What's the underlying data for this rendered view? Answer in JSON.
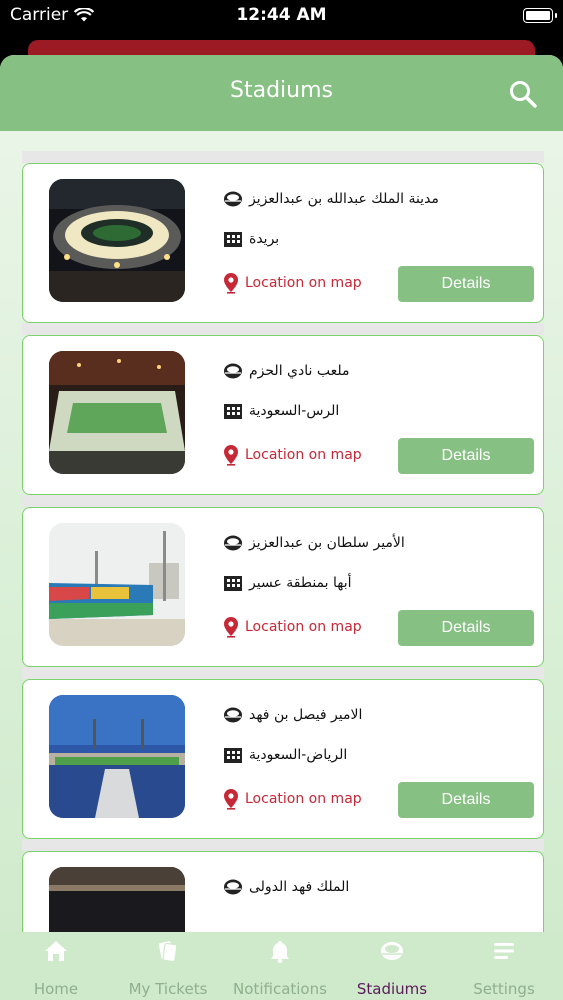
{
  "status_bar": {
    "carrier": "Carrier",
    "time": "12:44 AM"
  },
  "header": {
    "title": "Stadiums"
  },
  "stadiums": [
    {
      "name": "مدينة الملك عبدالله بن عبدالعزيز",
      "city": "بريدة",
      "location_label": "Location on map",
      "details_label": "Details"
    },
    {
      "name": "ملعب نادي الحزم",
      "city": "الرس-السعودية",
      "location_label": "Location on map",
      "details_label": "Details"
    },
    {
      "name": "الأمير سلطان بن عبدالعزيز",
      "city": "أبها بمنطقة عسير",
      "location_label": "Location on map",
      "details_label": "Details"
    },
    {
      "name": "الامير فيصل بن فهد",
      "city": "الرياض-السعودية",
      "location_label": "Location on map",
      "details_label": "Details"
    },
    {
      "name": "الملك فهد الدولى"
    }
  ],
  "tabs": [
    {
      "label": "Home",
      "icon": "home-icon"
    },
    {
      "label": "My Tickets",
      "icon": "tickets-icon"
    },
    {
      "label": "Notifications",
      "icon": "bell-icon"
    },
    {
      "label": "Stadiums",
      "icon": "stadium-icon",
      "active": true
    },
    {
      "label": "Settings",
      "icon": "menu-icon"
    }
  ],
  "colors": {
    "header": "#86c082",
    "accent_red": "#c62838",
    "card_border": "#7bd26b",
    "active_tab": "#5a1a5a"
  }
}
